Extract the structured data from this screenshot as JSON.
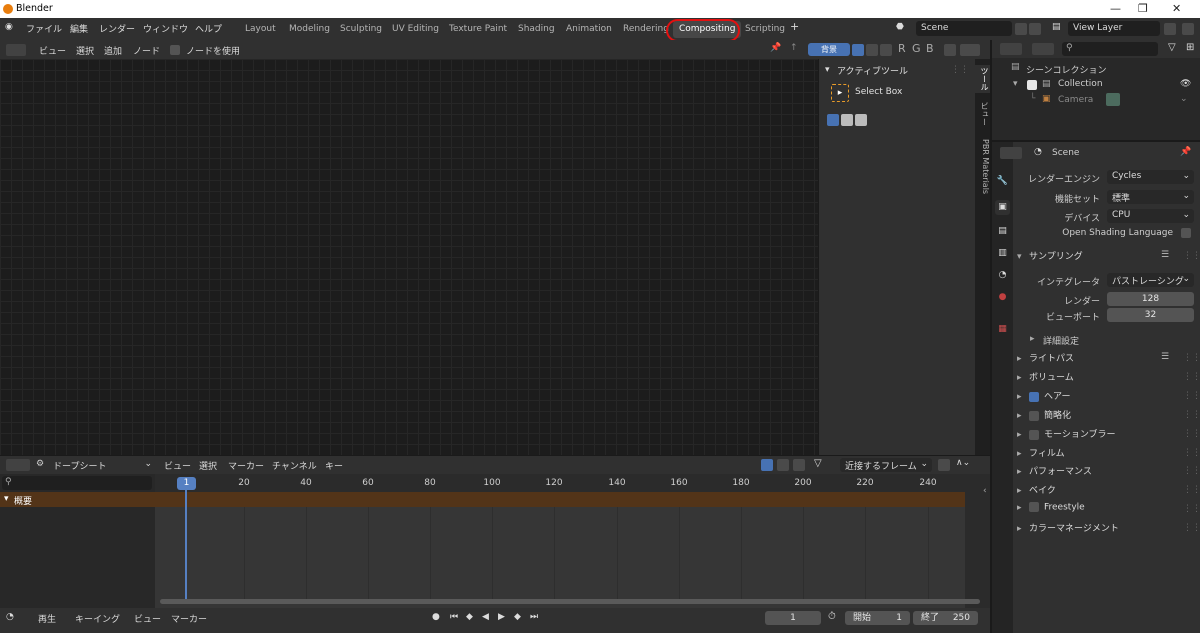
{
  "window": {
    "title": "Blender",
    "controls": [
      "—",
      "❐",
      "✕"
    ]
  },
  "menu": [
    "ファイル",
    "編集",
    "レンダー",
    "ウィンドウ",
    "ヘルプ"
  ],
  "workspaces": [
    "Layout",
    "Modeling",
    "Sculpting",
    "UV Editing",
    "Texture Paint",
    "Shading",
    "Animation",
    "Rendering",
    "Compositing",
    "Scripting"
  ],
  "active_workspace": "Compositing",
  "scene_selector": {
    "value": "Scene"
  },
  "viewlayer_selector": {
    "value": "View Layer"
  },
  "node_editor": {
    "menu": [
      "ビュー",
      "選択",
      "追加",
      "ノード"
    ],
    "use_nodes_label": "ノードを使用",
    "backdrop_label": "背景",
    "channels": [
      "R",
      "G",
      "B"
    ]
  },
  "npanel": {
    "section_title": "アクティブツール",
    "tool_name": "Select Box",
    "tabs": [
      "ツール",
      "ビュー",
      "PBR Materials"
    ]
  },
  "dopesheet": {
    "mode_label": "ドープシート",
    "menu": [
      "ビュー",
      "選択",
      "マーカー",
      "チャンネル",
      "キー"
    ],
    "snap_label": "近接するフレーム",
    "summary_label": "概要",
    "current_frame": "1",
    "ruler_ticks": [
      "20",
      "40",
      "60",
      "80",
      "100",
      "120",
      "140",
      "160",
      "180",
      "200",
      "220",
      "240"
    ]
  },
  "playback": {
    "menu": [
      "再生",
      "キーイング",
      "ビュー",
      "マーカー"
    ],
    "frame": "1",
    "start_label": "開始",
    "start_value": "1",
    "end_label": "終了",
    "end_value": "250"
  },
  "outliner": {
    "scene_collection": "シーンコレクション",
    "collection": "Collection",
    "camera": "Camera"
  },
  "properties": {
    "header_scene": "Scene",
    "render_engine_label": "レンダーエンジン",
    "render_engine_value": "Cycles",
    "feature_set_label": "機能セット",
    "feature_set_value": "標準",
    "device_label": "デバイス",
    "device_value": "CPU",
    "osl_label": "Open Shading Language",
    "sampling_title": "サンプリング",
    "integrator_label": "インテグレータ",
    "integrator_value": "パストレーシング",
    "render_label": "レンダー",
    "render_value": "128",
    "viewport_label": "ビューポート",
    "viewport_value": "32",
    "advanced_label": "詳細設定",
    "sections": [
      {
        "label": "ライトパス",
        "checkbox": null
      },
      {
        "label": "ボリューム",
        "checkbox": null
      },
      {
        "label": "ヘアー",
        "checkbox": "on"
      },
      {
        "label": "簡略化",
        "checkbox": "off"
      },
      {
        "label": "モーションブラー",
        "checkbox": "off"
      },
      {
        "label": "フィルム",
        "checkbox": null
      },
      {
        "label": "パフォーマンス",
        "checkbox": null
      },
      {
        "label": "ベイク",
        "checkbox": null
      },
      {
        "label": "Freestyle",
        "checkbox": "off"
      },
      {
        "label": "カラーマネージメント",
        "checkbox": null
      }
    ]
  },
  "colors": {
    "accent": "#4772b3",
    "highlight_ring": "#e31010",
    "playhead": "#5680c2",
    "summary_row": "#533418"
  }
}
